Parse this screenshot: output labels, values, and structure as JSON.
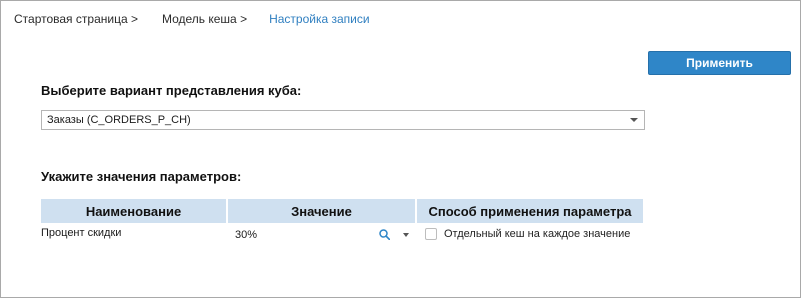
{
  "breadcrumb": {
    "items": [
      "Стартовая страница >",
      "Модель кеша >",
      "Настройка записи"
    ]
  },
  "toolbar": {
    "apply_label": "Применить"
  },
  "cube": {
    "title": "Выберите вариант представления куба:",
    "selected": "Заказы (C_ORDERS_P_CH)"
  },
  "params": {
    "title": "Укажите значения параметров:",
    "headers": {
      "name": "Наименование",
      "value": "Значение",
      "method": "Способ применения параметра"
    },
    "rows": [
      {
        "name": "Процент скидки",
        "value": "30%",
        "method_label": "Отдельный кеш на каждое значение",
        "method_checked": false
      }
    ]
  },
  "colors": {
    "accent": "#2f86c8",
    "breadcrumb_active": "#2f7fc0",
    "table_header_bg": "#cfe0f0"
  },
  "icons": {
    "search": "search-icon",
    "dropdown": "chevron-down-icon"
  }
}
